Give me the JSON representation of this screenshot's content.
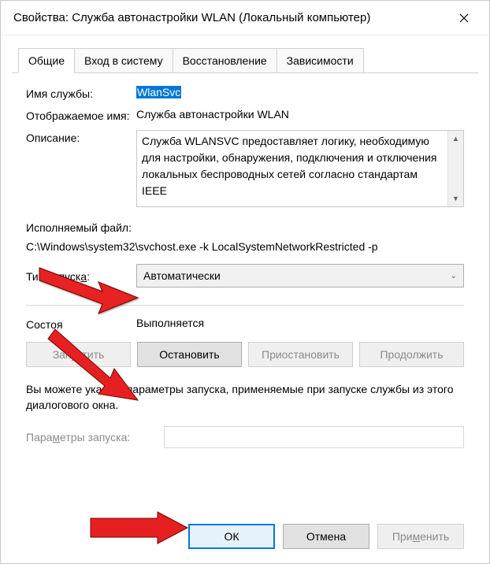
{
  "window": {
    "title": "Свойства: Служба автонастройки WLAN (Локальный компьютер)"
  },
  "tabs": {
    "general": "Общие",
    "logon": "Вход в систему",
    "recovery": "Восстановление",
    "dependencies": "Зависимости"
  },
  "fields": {
    "service_name_label": "Имя службы:",
    "service_name_value": "WlanSvc",
    "display_name_label": "Отображаемое имя:",
    "display_name_value": "Служба автонастройки WLAN",
    "description_label": "Описание:",
    "description_value": "Служба WLANSVC предоставляет логику, необходимую для настройки, обнаружения, подключения и отключения локальных беспроводных сетей согласно стандартам IEEE",
    "exe_label": "Исполняемый файл:",
    "exe_path": "C:\\Windows\\system32\\svchost.exe -k LocalSystemNetworkRestricted -p",
    "startup_type_label_pre": "Тип запуск",
    "startup_type_label_und": "а",
    "startup_type_label_post": ":",
    "startup_type_value": "Автоматически",
    "status_label": "Состоя",
    "status_value": "Выполняется",
    "params_label_pre": "Пара",
    "params_label_und": "м",
    "params_label_post": "етры запуска:",
    "note": "Вы можете указать параметры запуска, применяемые при запуске службы из этого диалогового окна."
  },
  "buttons": {
    "start": "Запустить",
    "stop": "Остановить",
    "pause": "Приостановить",
    "resume": "Продолжить",
    "ok": "ОК",
    "cancel": "Отмена",
    "apply_pre": "При",
    "apply_und": "м",
    "apply_post": "енить"
  }
}
